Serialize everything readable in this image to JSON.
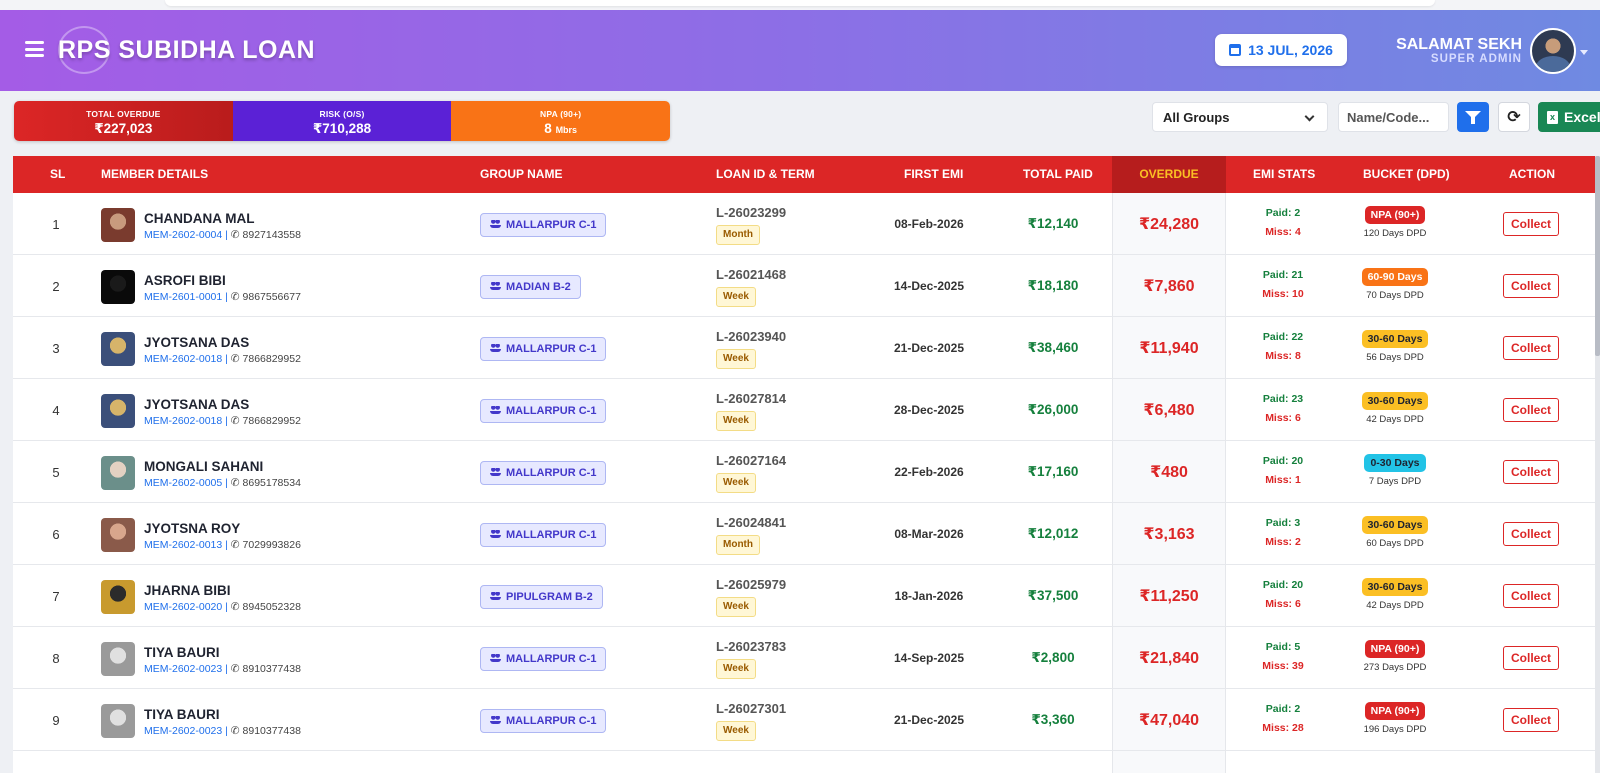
{
  "app": {
    "title": "RPS SUBIDHA LOAN",
    "logo_mark": "RPS"
  },
  "header": {
    "date": "13 JUL, 2026",
    "user_name": "SALAMAT SEKH",
    "user_role": "SUPER ADMIN",
    "gradient": [
      "#a45ce6",
      "#6f8ae2"
    ]
  },
  "stats": [
    {
      "label": "TOTAL OVERDUE",
      "value": "₹227,023"
    },
    {
      "label": "RISK (O/S)",
      "value": "₹710,288"
    },
    {
      "label": "NPA (90+)",
      "value": "8",
      "unit": "Mbrs"
    }
  ],
  "filters": {
    "group_select": "All Groups",
    "search_placeholder": "Name/Code...",
    "excel_label": "Excel",
    "icons": [
      "filter-icon",
      "refresh-icon",
      "excel-file-icon",
      "calendar-icon",
      "chevron-down-icon",
      "menu-icon"
    ]
  },
  "table": {
    "headers": {
      "sl": "SL",
      "member": "MEMBER DETAILS",
      "group": "GROUP NAME",
      "loan": "LOAN ID & TERM",
      "first_emi": "FIRST EMI",
      "total_paid": "TOTAL PAID",
      "overdue": "OVERDUE",
      "emi_stats": "EMI STATS",
      "bucket": "BUCKET (DPD)",
      "action": "ACTION"
    },
    "action_label": "Collect",
    "rows": [
      {
        "sl": "1",
        "name": "CHANDANA MAL",
        "code": "MEM-2602-0004",
        "phone": "8927143558",
        "group": "MALLARPUR C-1",
        "loan_id": "L-26023299",
        "term": "Month",
        "first_emi": "08-Feb-2026",
        "total_paid": "₹12,140",
        "overdue": "₹24,280",
        "paid": "Paid: 2",
        "miss": "Miss: 4",
        "bucket": "NPA (90+)",
        "bucket_color": "#dc2626",
        "bucket_text": "#ffffff",
        "dpd": "120 Days DPD"
      },
      {
        "sl": "2",
        "name": "ASROFI BIBI",
        "code": "MEM-2601-0001",
        "phone": "9867556677",
        "group": "MADIAN B-2",
        "loan_id": "L-26021468",
        "term": "Week",
        "first_emi": "14-Dec-2025",
        "total_paid": "₹18,180",
        "overdue": "₹7,860",
        "paid": "Paid: 21",
        "miss": "Miss: 10",
        "bucket": "60-90 Days",
        "bucket_color": "#f97316",
        "bucket_text": "#ffffff",
        "dpd": "70 Days DPD"
      },
      {
        "sl": "3",
        "name": "JYOTSANA DAS",
        "code": "MEM-2602-0018",
        "phone": "7866829952",
        "group": "MALLARPUR C-1",
        "loan_id": "L-26023940",
        "term": "Week",
        "first_emi": "21-Dec-2025",
        "total_paid": "₹38,460",
        "overdue": "₹11,940",
        "paid": "Paid: 22",
        "miss": "Miss: 8",
        "bucket": "30-60 Days",
        "bucket_color": "#fbbf24",
        "bucket_text": "#1f2330",
        "dpd": "56 Days DPD"
      },
      {
        "sl": "4",
        "name": "JYOTSANA DAS",
        "code": "MEM-2602-0018",
        "phone": "7866829952",
        "group": "MALLARPUR C-1",
        "loan_id": "L-26027814",
        "term": "Week",
        "first_emi": "28-Dec-2025",
        "total_paid": "₹26,000",
        "overdue": "₹6,480",
        "paid": "Paid: 23",
        "miss": "Miss: 6",
        "bucket": "30-60 Days",
        "bucket_color": "#fbbf24",
        "bucket_text": "#1f2330",
        "dpd": "42 Days DPD"
      },
      {
        "sl": "5",
        "name": "MONGALI SAHANI",
        "code": "MEM-2602-0005",
        "phone": "8695178534",
        "group": "MALLARPUR C-1",
        "loan_id": "L-26027164",
        "term": "Week",
        "first_emi": "22-Feb-2026",
        "total_paid": "₹17,160",
        "overdue": "₹480",
        "paid": "Paid: 20",
        "miss": "Miss: 1",
        "bucket": "0-30 Days",
        "bucket_color": "#22c3e6",
        "bucket_text": "#1f2330",
        "dpd": "7 Days DPD"
      },
      {
        "sl": "6",
        "name": "JYOTSNA ROY",
        "code": "MEM-2602-0013",
        "phone": "7029993826",
        "group": "MALLARPUR C-1",
        "loan_id": "L-26024841",
        "term": "Month",
        "first_emi": "08-Mar-2026",
        "total_paid": "₹12,012",
        "overdue": "₹3,163",
        "paid": "Paid: 3",
        "miss": "Miss: 2",
        "bucket": "30-60 Days",
        "bucket_color": "#fbbf24",
        "bucket_text": "#1f2330",
        "dpd": "60 Days DPD"
      },
      {
        "sl": "7",
        "name": "JHARNA BIBI",
        "code": "MEM-2602-0020",
        "phone": "8945052328",
        "group": "PIPULGRAM B-2",
        "loan_id": "L-26025979",
        "term": "Week",
        "first_emi": "18-Jan-2026",
        "total_paid": "₹37,500",
        "overdue": "₹11,250",
        "paid": "Paid: 20",
        "miss": "Miss: 6",
        "bucket": "30-60 Days",
        "bucket_color": "#fbbf24",
        "bucket_text": "#1f2330",
        "dpd": "42 Days DPD"
      },
      {
        "sl": "8",
        "name": "TIYA BAURI",
        "code": "MEM-2602-0023",
        "phone": "8910377438",
        "group": "MALLARPUR C-1",
        "loan_id": "L-26023783",
        "term": "Week",
        "first_emi": "14-Sep-2025",
        "total_paid": "₹2,800",
        "overdue": "₹21,840",
        "paid": "Paid: 5",
        "miss": "Miss: 39",
        "bucket": "NPA (90+)",
        "bucket_color": "#dc2626",
        "bucket_text": "#ffffff",
        "dpd": "273 Days DPD"
      },
      {
        "sl": "9",
        "name": "TIYA BAURI",
        "code": "MEM-2602-0023",
        "phone": "8910377438",
        "group": "MALLARPUR C-1",
        "loan_id": "L-26027301",
        "term": "Week",
        "first_emi": "21-Dec-2025",
        "total_paid": "₹3,360",
        "overdue": "₹47,040",
        "paid": "Paid: 2",
        "miss": "Miss: 28",
        "bucket": "NPA (90+)",
        "bucket_color": "#dc2626",
        "bucket_text": "#ffffff",
        "dpd": "196 Days DPD"
      }
    ]
  },
  "colors": {
    "header_bg": "#dc2626",
    "overdue_text": "#dc2626",
    "paid_text": "#15803d",
    "link_blue": "#1f6feb"
  }
}
